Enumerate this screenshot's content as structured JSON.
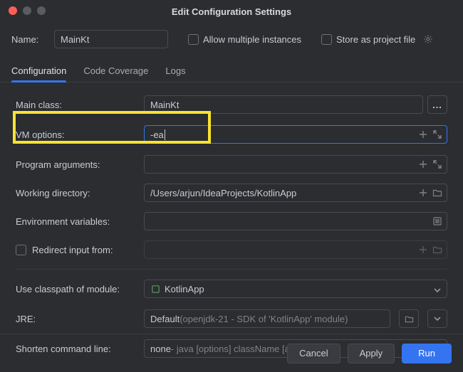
{
  "window": {
    "title": "Edit Configuration Settings"
  },
  "name": {
    "label": "Name:",
    "value": "MainKt"
  },
  "options": {
    "allow_multiple": "Allow multiple instances",
    "store_as_project": "Store as project file"
  },
  "tabs": {
    "configuration": "Configuration",
    "code_coverage": "Code Coverage",
    "logs": "Logs"
  },
  "form": {
    "main_class": {
      "label": "Main class:",
      "value": "MainKt"
    },
    "vm_options": {
      "label": "VM options:",
      "value": "-ea"
    },
    "program_args": {
      "label": "Program arguments:",
      "value": ""
    },
    "working_dir": {
      "label": "Working directory:",
      "value": "/Users/arjun/IdeaProjects/KotlinApp"
    },
    "env_vars": {
      "label": "Environment variables:",
      "value": ""
    },
    "redirect_input": {
      "label": "Redirect input from:",
      "value": ""
    },
    "classpath": {
      "label": "Use classpath of module:",
      "value": "KotlinApp"
    },
    "jre": {
      "label": "JRE:",
      "value": "Default",
      "hint": " (openjdk-21 - SDK of 'KotlinApp' module)"
    },
    "shorten": {
      "label": "Shorten command line:",
      "value": "none",
      "hint": " - java [options] className [args]"
    }
  },
  "buttons": {
    "cancel": "Cancel",
    "apply": "Apply",
    "run": "Run"
  }
}
